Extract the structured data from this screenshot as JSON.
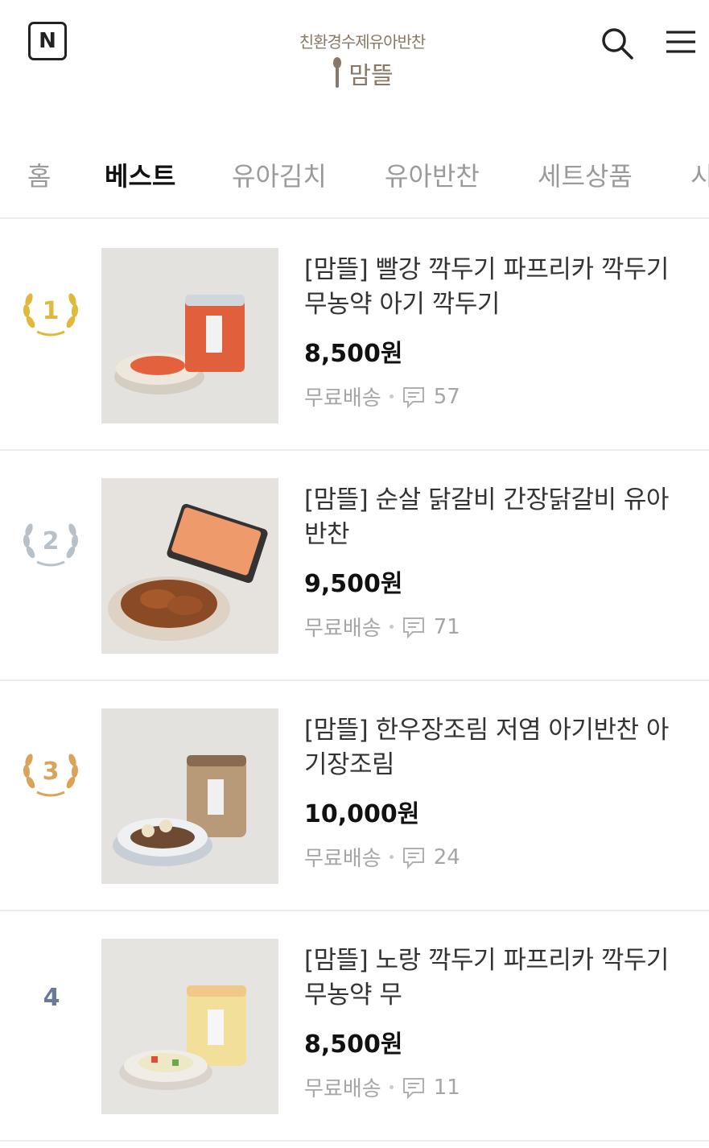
{
  "header": {
    "logo_letter": "N",
    "brand_sub": "친환경수제유아반찬",
    "brand_main": "맘뜰"
  },
  "tabs": [
    "홈",
    "베스트",
    "유아김치",
    "유아반찬",
    "세트상품",
    "시"
  ],
  "active_tab": "베스트",
  "colors": {
    "rank1": "#e0b93b",
    "rank2": "#b9c1c8",
    "rank3": "#d9a35a",
    "rank4": "#6a7a96",
    "brand": "#8a7866"
  },
  "products": [
    {
      "rank": "1",
      "title": "[맘뜰] 빨강 깍두기 파프리카 깍두기 무농약 아기 깍두기",
      "price": "8,500원",
      "shipping": "무료배송",
      "comments": "57"
    },
    {
      "rank": "2",
      "title": "[맘뜰] 순살 닭갈비 간장닭갈비 유아반찬",
      "price": "9,500원",
      "shipping": "무료배송",
      "comments": "71"
    },
    {
      "rank": "3",
      "title": "[맘뜰] 한우장조림 저염 아기반찬 아기장조림",
      "price": "10,000원",
      "shipping": "무료배송",
      "comments": "24"
    },
    {
      "rank": "4",
      "title": "[맘뜰] 노랑 깍두기 파프리카 깍두기 무농약 무",
      "price": "8,500원",
      "shipping": "무료배송",
      "comments": "11"
    }
  ]
}
